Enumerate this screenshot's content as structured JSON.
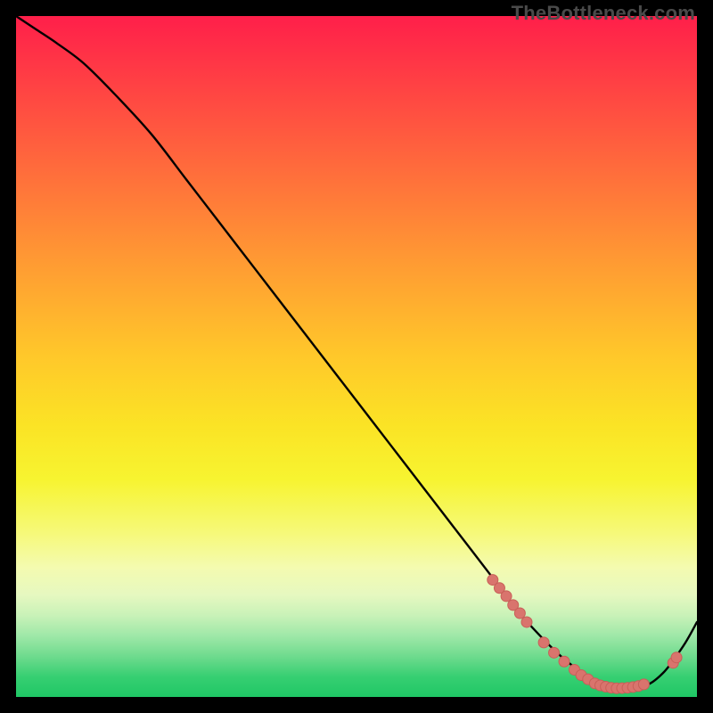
{
  "watermark": "TheBottleneck.com",
  "colors": {
    "frame": "#000000",
    "curve": "#000000",
    "marker_fill": "#d9746d",
    "marker_stroke": "#c85f58"
  },
  "chart_data": {
    "type": "line",
    "title": "",
    "xlabel": "",
    "ylabel": "",
    "xlim": [
      0,
      100
    ],
    "ylim": [
      0,
      100
    ],
    "grid": false,
    "series": [
      {
        "name": "curve",
        "x": [
          0,
          3,
          6,
          10,
          15,
          20,
          25,
          30,
          35,
          40,
          45,
          50,
          55,
          60,
          65,
          70,
          73,
          76,
          80,
          84,
          88,
          92,
          95,
          98,
          100
        ],
        "y": [
          100,
          98,
          96,
          93,
          88,
          82.5,
          76,
          69.5,
          63,
          56.5,
          50,
          43.5,
          37,
          30.5,
          24,
          17.5,
          13.5,
          10,
          6,
          3,
          1.3,
          1.5,
          3.5,
          7.5,
          11
        ]
      }
    ],
    "markers": [
      {
        "x": 70.0,
        "y": 17.2
      },
      {
        "x": 71.0,
        "y": 16.0
      },
      {
        "x": 72.0,
        "y": 14.8
      },
      {
        "x": 73.0,
        "y": 13.5
      },
      {
        "x": 74.0,
        "y": 12.3
      },
      {
        "x": 75.0,
        "y": 11.0
      },
      {
        "x": 77.5,
        "y": 8.0
      },
      {
        "x": 79.0,
        "y": 6.5
      },
      {
        "x": 80.5,
        "y": 5.2
      },
      {
        "x": 82.0,
        "y": 4.0
      },
      {
        "x": 83.0,
        "y": 3.2
      },
      {
        "x": 84.0,
        "y": 2.6
      },
      {
        "x": 85.0,
        "y": 2.0
      },
      {
        "x": 85.8,
        "y": 1.7
      },
      {
        "x": 86.6,
        "y": 1.5
      },
      {
        "x": 87.4,
        "y": 1.35
      },
      {
        "x": 88.2,
        "y": 1.28
      },
      {
        "x": 89.0,
        "y": 1.3
      },
      {
        "x": 89.8,
        "y": 1.35
      },
      {
        "x": 90.6,
        "y": 1.45
      },
      {
        "x": 91.4,
        "y": 1.6
      },
      {
        "x": 92.2,
        "y": 1.85
      },
      {
        "x": 96.5,
        "y": 5.0
      },
      {
        "x": 97.0,
        "y": 5.8
      }
    ]
  }
}
